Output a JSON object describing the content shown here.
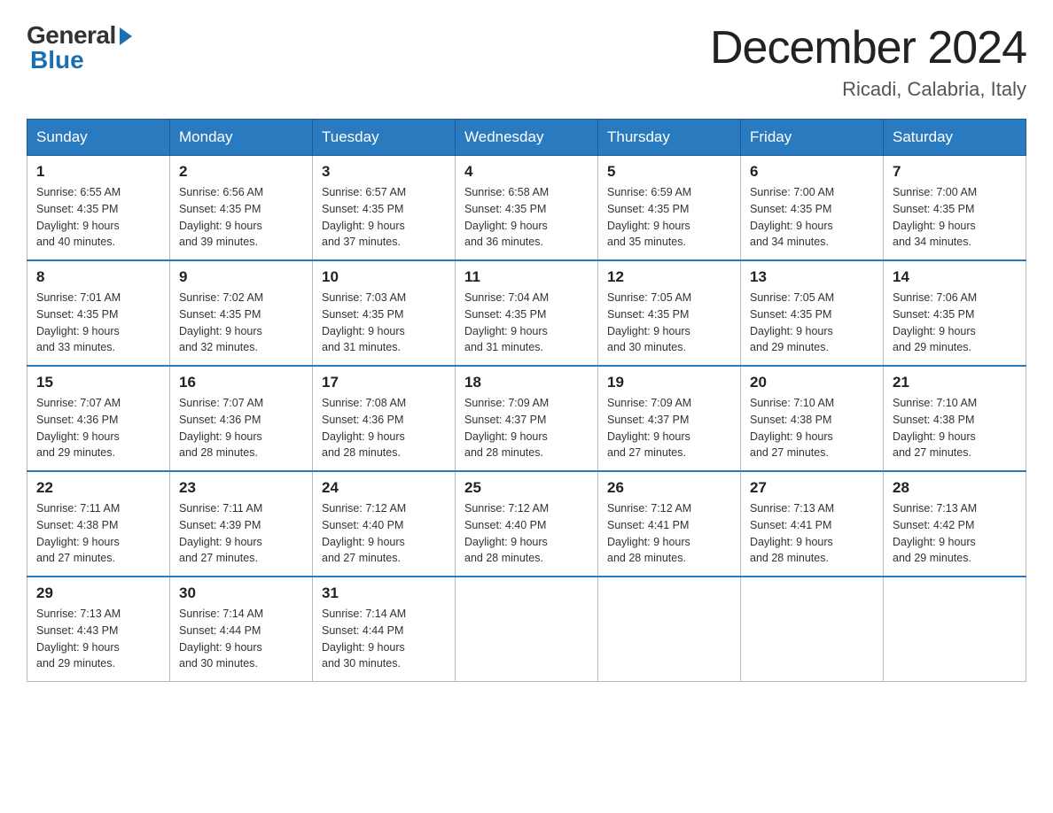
{
  "header": {
    "logo_general": "General",
    "logo_blue": "Blue",
    "title": "December 2024",
    "location": "Ricadi, Calabria, Italy"
  },
  "days_of_week": [
    "Sunday",
    "Monday",
    "Tuesday",
    "Wednesday",
    "Thursday",
    "Friday",
    "Saturday"
  ],
  "weeks": [
    [
      {
        "num": "1",
        "sunrise": "6:55 AM",
        "sunset": "4:35 PM",
        "daylight": "9 hours and 40 minutes."
      },
      {
        "num": "2",
        "sunrise": "6:56 AM",
        "sunset": "4:35 PM",
        "daylight": "9 hours and 39 minutes."
      },
      {
        "num": "3",
        "sunrise": "6:57 AM",
        "sunset": "4:35 PM",
        "daylight": "9 hours and 37 minutes."
      },
      {
        "num": "4",
        "sunrise": "6:58 AM",
        "sunset": "4:35 PM",
        "daylight": "9 hours and 36 minutes."
      },
      {
        "num": "5",
        "sunrise": "6:59 AM",
        "sunset": "4:35 PM",
        "daylight": "9 hours and 35 minutes."
      },
      {
        "num": "6",
        "sunrise": "7:00 AM",
        "sunset": "4:35 PM",
        "daylight": "9 hours and 34 minutes."
      },
      {
        "num": "7",
        "sunrise": "7:00 AM",
        "sunset": "4:35 PM",
        "daylight": "9 hours and 34 minutes."
      }
    ],
    [
      {
        "num": "8",
        "sunrise": "7:01 AM",
        "sunset": "4:35 PM",
        "daylight": "9 hours and 33 minutes."
      },
      {
        "num": "9",
        "sunrise": "7:02 AM",
        "sunset": "4:35 PM",
        "daylight": "9 hours and 32 minutes."
      },
      {
        "num": "10",
        "sunrise": "7:03 AM",
        "sunset": "4:35 PM",
        "daylight": "9 hours and 31 minutes."
      },
      {
        "num": "11",
        "sunrise": "7:04 AM",
        "sunset": "4:35 PM",
        "daylight": "9 hours and 31 minutes."
      },
      {
        "num": "12",
        "sunrise": "7:05 AM",
        "sunset": "4:35 PM",
        "daylight": "9 hours and 30 minutes."
      },
      {
        "num": "13",
        "sunrise": "7:05 AM",
        "sunset": "4:35 PM",
        "daylight": "9 hours and 29 minutes."
      },
      {
        "num": "14",
        "sunrise": "7:06 AM",
        "sunset": "4:35 PM",
        "daylight": "9 hours and 29 minutes."
      }
    ],
    [
      {
        "num": "15",
        "sunrise": "7:07 AM",
        "sunset": "4:36 PM",
        "daylight": "9 hours and 29 minutes."
      },
      {
        "num": "16",
        "sunrise": "7:07 AM",
        "sunset": "4:36 PM",
        "daylight": "9 hours and 28 minutes."
      },
      {
        "num": "17",
        "sunrise": "7:08 AM",
        "sunset": "4:36 PM",
        "daylight": "9 hours and 28 minutes."
      },
      {
        "num": "18",
        "sunrise": "7:09 AM",
        "sunset": "4:37 PM",
        "daylight": "9 hours and 28 minutes."
      },
      {
        "num": "19",
        "sunrise": "7:09 AM",
        "sunset": "4:37 PM",
        "daylight": "9 hours and 27 minutes."
      },
      {
        "num": "20",
        "sunrise": "7:10 AM",
        "sunset": "4:38 PM",
        "daylight": "9 hours and 27 minutes."
      },
      {
        "num": "21",
        "sunrise": "7:10 AM",
        "sunset": "4:38 PM",
        "daylight": "9 hours and 27 minutes."
      }
    ],
    [
      {
        "num": "22",
        "sunrise": "7:11 AM",
        "sunset": "4:38 PM",
        "daylight": "9 hours and 27 minutes."
      },
      {
        "num": "23",
        "sunrise": "7:11 AM",
        "sunset": "4:39 PM",
        "daylight": "9 hours and 27 minutes."
      },
      {
        "num": "24",
        "sunrise": "7:12 AM",
        "sunset": "4:40 PM",
        "daylight": "9 hours and 27 minutes."
      },
      {
        "num": "25",
        "sunrise": "7:12 AM",
        "sunset": "4:40 PM",
        "daylight": "9 hours and 28 minutes."
      },
      {
        "num": "26",
        "sunrise": "7:12 AM",
        "sunset": "4:41 PM",
        "daylight": "9 hours and 28 minutes."
      },
      {
        "num": "27",
        "sunrise": "7:13 AM",
        "sunset": "4:41 PM",
        "daylight": "9 hours and 28 minutes."
      },
      {
        "num": "28",
        "sunrise": "7:13 AM",
        "sunset": "4:42 PM",
        "daylight": "9 hours and 29 minutes."
      }
    ],
    [
      {
        "num": "29",
        "sunrise": "7:13 AM",
        "sunset": "4:43 PM",
        "daylight": "9 hours and 29 minutes."
      },
      {
        "num": "30",
        "sunrise": "7:14 AM",
        "sunset": "4:44 PM",
        "daylight": "9 hours and 30 minutes."
      },
      {
        "num": "31",
        "sunrise": "7:14 AM",
        "sunset": "4:44 PM",
        "daylight": "9 hours and 30 minutes."
      },
      null,
      null,
      null,
      null
    ]
  ],
  "labels": {
    "sunrise": "Sunrise:",
    "sunset": "Sunset:",
    "daylight": "Daylight:"
  }
}
